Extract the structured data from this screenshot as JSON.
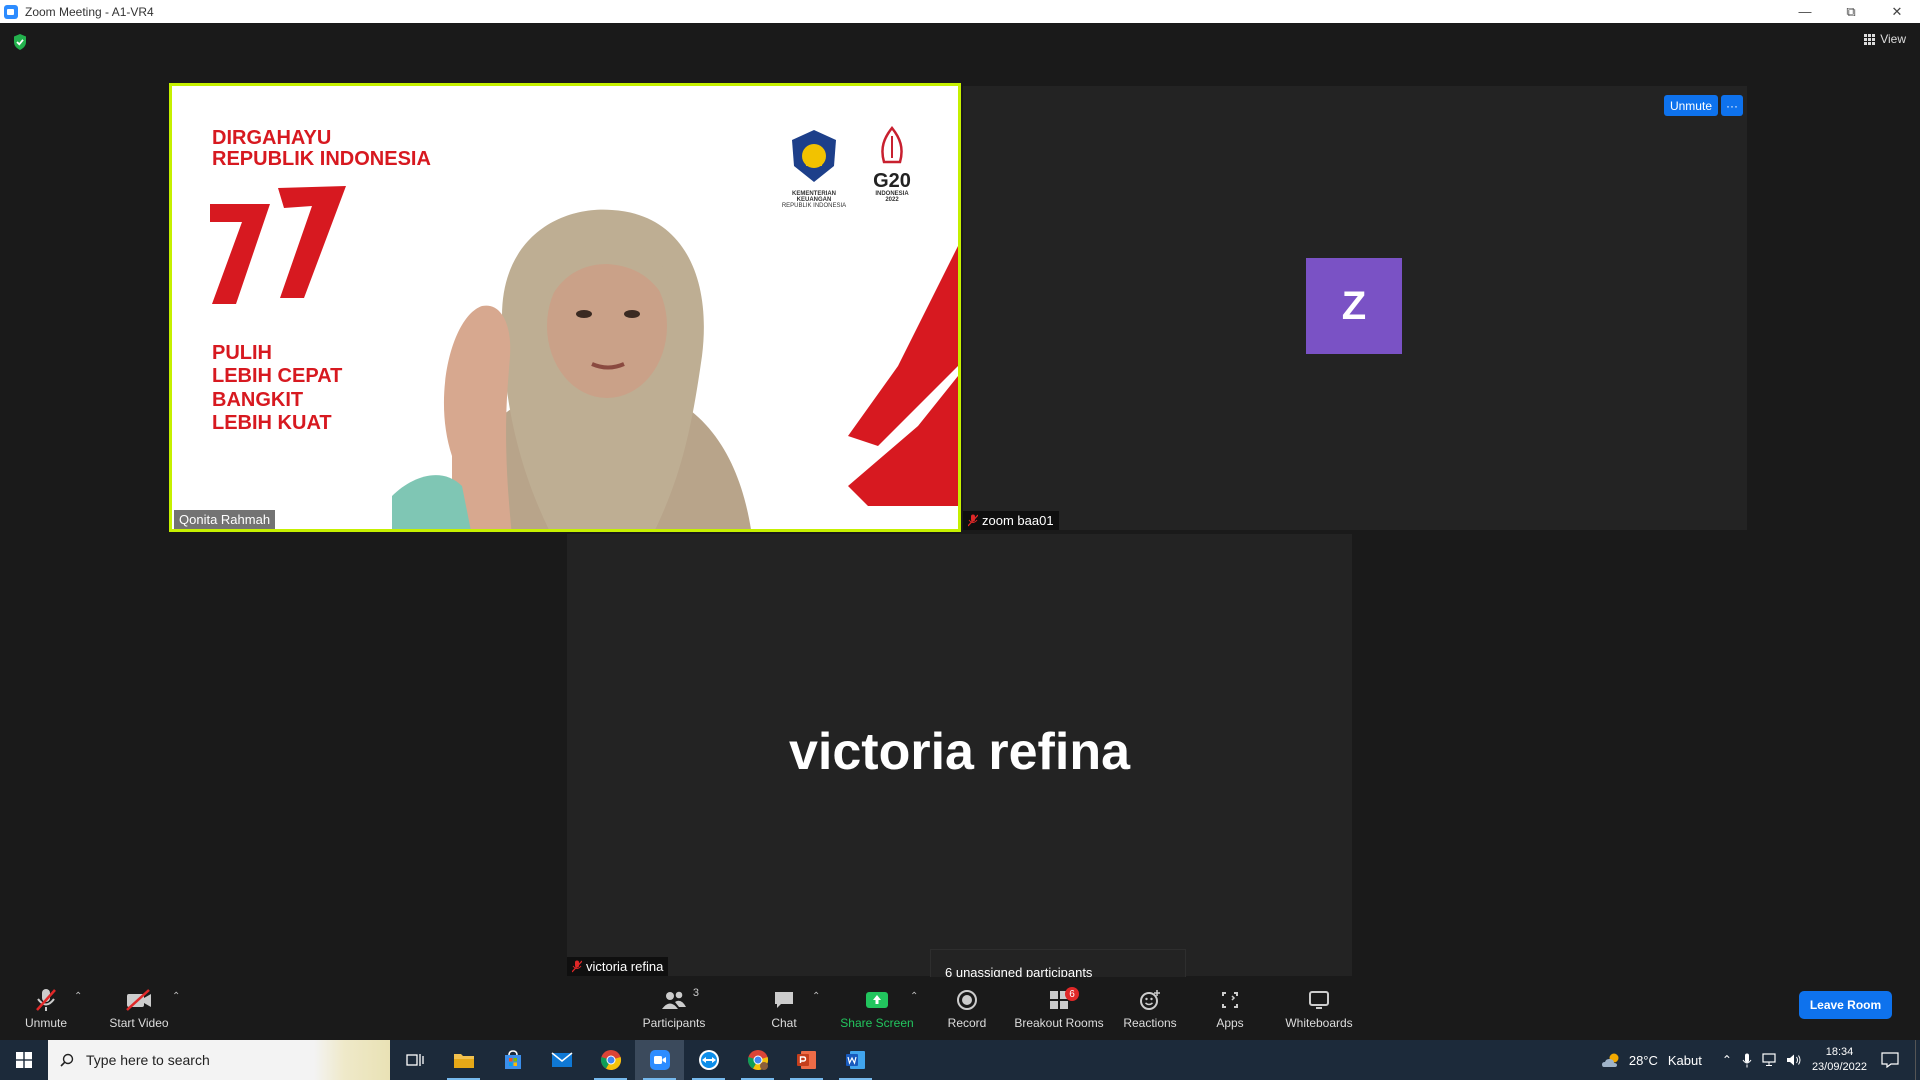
{
  "window": {
    "title": "Zoom Meeting - A1-VR4"
  },
  "top_bar": {
    "view_label": "View"
  },
  "tiles": [
    {
      "name": "Qonita Rahmah",
      "muted": false,
      "background_text": {
        "greeting_line1": "DIRGAHAYU",
        "greeting_line2": "REPUBLIK INDONESIA",
        "number": "77",
        "slogan": [
          "PULIH",
          "LEBIH CEPAT",
          "BANGKIT",
          "LEBIH KUAT"
        ],
        "logo1_caption1": "KEMENTERIAN KEUANGAN",
        "logo1_caption2": "REPUBLIK INDONESIA",
        "logo2_text": "G20",
        "logo2_caption1": "INDONESIA",
        "logo2_caption2": "2022"
      }
    },
    {
      "name": "zoom baa01",
      "muted": true,
      "avatar_letter": "Z",
      "avatar_color": "#7a52c5",
      "unmute_label": "Unmute",
      "more_label": "···"
    },
    {
      "name": "victoria refina",
      "muted": true,
      "display_name": "victoria refina"
    }
  ],
  "tooltip": {
    "text": "6 unassigned participants"
  },
  "toolbar": {
    "unmute": "Unmute",
    "start_video": "Start Video",
    "participants": "Participants",
    "participants_count": "3",
    "chat": "Chat",
    "share_screen": "Share Screen",
    "record": "Record",
    "breakout_rooms": "Breakout Rooms",
    "breakout_badge": "6",
    "reactions": "Reactions",
    "apps": "Apps",
    "whiteboards": "Whiteboards",
    "leave": "Leave Room"
  },
  "taskbar": {
    "search_placeholder": "Type here to search",
    "weather_temp": "28°C",
    "weather_desc": "Kabut",
    "time": "18:34",
    "date": "23/09/2022"
  },
  "colors": {
    "accent": "#0e72ed",
    "active_speaker_border": "#c5f000",
    "share_green": "#22c55e",
    "badge_red": "#e02828"
  }
}
